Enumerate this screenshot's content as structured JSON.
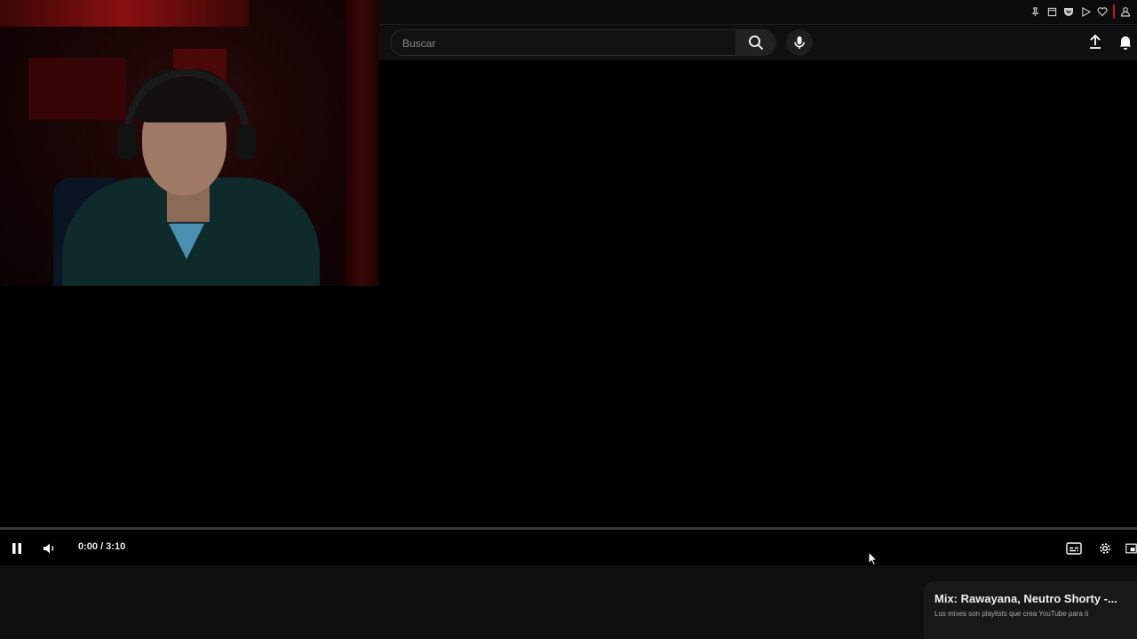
{
  "search": {
    "placeholder": "Buscar"
  },
  "player": {
    "time_display": "0:00 / 3:10",
    "progress_fraction": 0
  },
  "mix_card": {
    "title": "Mix: Rawayana, Neutro Shorty -...",
    "subtitle": "Los mixes son playlists que crea YouTube para ti"
  },
  "icons": {
    "extensions": [
      "pin-icon",
      "tab-icon",
      "pocket-icon",
      "play-icon",
      "heart-icon",
      "profile-icon"
    ],
    "header": [
      "search-icon",
      "mic-icon",
      "upload-icon",
      "bell-icon"
    ],
    "controls": [
      "pause-icon",
      "volume-icon",
      "subtitles-icon",
      "settings-icon",
      "miniplayer-icon"
    ]
  },
  "colors": {
    "accent": "#c8102e",
    "background": "#000000",
    "header": "#0f0f0f"
  }
}
